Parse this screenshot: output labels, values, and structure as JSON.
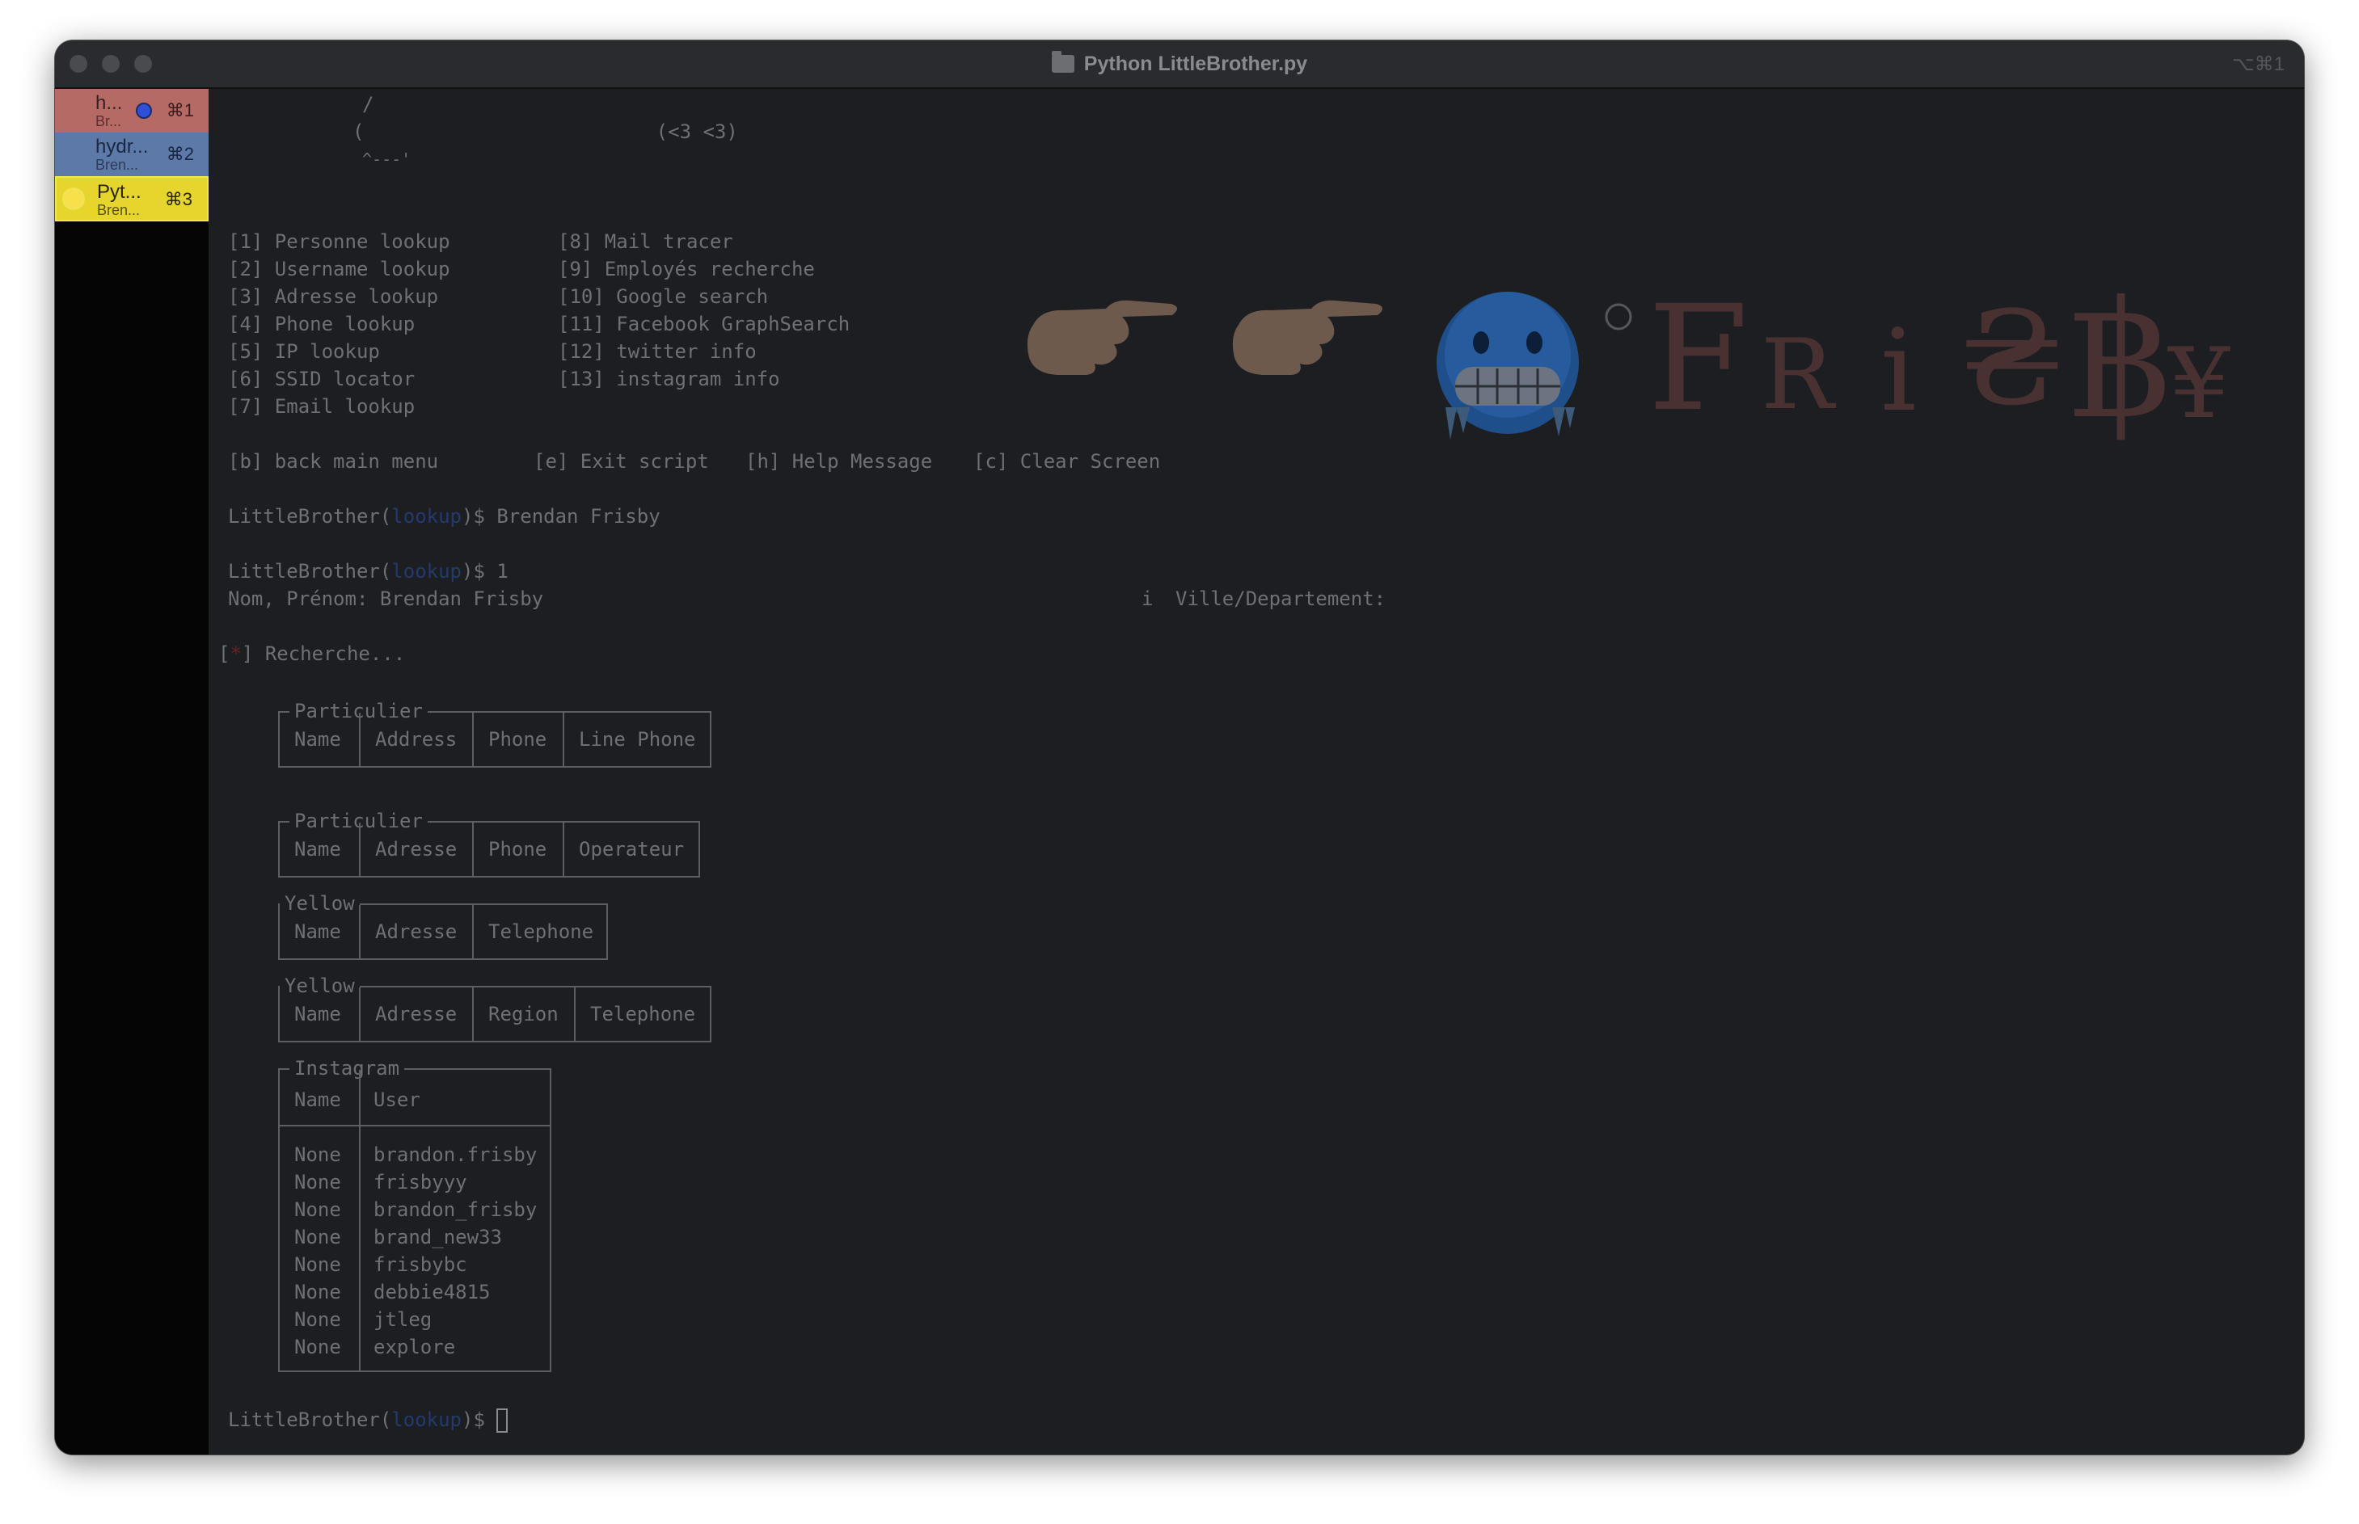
{
  "window": {
    "title": "Python LittleBrother.py",
    "shortcut": "⌥⌘1"
  },
  "sidebar": {
    "tabs": [
      {
        "name": "h...",
        "sub": "Br...",
        "key": "⌘1"
      },
      {
        "name": "hydr...",
        "sub": "Bren...",
        "key": "⌘2"
      },
      {
        "name": "Pyt...",
        "sub": "Bren...",
        "key": "⌘3"
      }
    ]
  },
  "ascii_art": {
    "line1": "/",
    "line2": "(                         (<3 <3)",
    "line3": "^---'"
  },
  "menu": {
    "left": [
      "[1] Personne lookup",
      "[2] Username lookup",
      "[3] Adresse lookup",
      "[4] Phone lookup",
      "[5] IP lookup",
      "[6] SSID locator",
      "[7] Email lookup"
    ],
    "right": [
      "[8] Mail tracer",
      "[9] Employés recherche",
      "[10] Google search",
      "[11] Facebook GraphSearch",
      "[12] twitter info",
      "[13] instagram info"
    ],
    "options": [
      "[b] back main menu",
      "[e] Exit script",
      "[h] Help Message",
      "[c] Clear Screen"
    ]
  },
  "banner": {
    "letters": [
      "F",
      "R",
      "i",
      "₴",
      "฿",
      "¥"
    ]
  },
  "prompt": {
    "prefix": "LittleBrother(",
    "module": "lookup",
    "suffix": ")$"
  },
  "session": {
    "cmd1": " Brendan Frisby",
    "cmd2": " 1",
    "name_line": "Nom, Prénom: Brendan Frisby",
    "ville_marker": "i",
    "ville_line": "Ville/Departement:",
    "search_star": "*",
    "search_text": "Recherche..."
  },
  "tables": [
    {
      "label": "Particulier",
      "columns": [
        "Name",
        "Address",
        "Phone",
        "Line Phone"
      ]
    },
    {
      "label": "Particulier",
      "columns": [
        "Name",
        "Adresse",
        "Phone",
        "Operateur"
      ]
    },
    {
      "label": "Yellow",
      "columns": [
        "Name",
        "Adresse",
        "Telephone"
      ]
    },
    {
      "label": "Yellow",
      "columns": [
        "Name",
        "Adresse",
        "Region",
        "Telephone"
      ]
    }
  ],
  "instagram": {
    "label": "Instagram",
    "columns": [
      "Name",
      "User"
    ],
    "rows": [
      [
        "None",
        "brandon.frisby"
      ],
      [
        "None",
        "frisbyyy"
      ],
      [
        "None",
        "brandon_frisby"
      ],
      [
        "None",
        "brand_new33"
      ],
      [
        "None",
        "frisbybc"
      ],
      [
        "None",
        "debbie4815"
      ],
      [
        "None",
        "jtleg"
      ],
      [
        "None",
        "explore"
      ]
    ]
  }
}
